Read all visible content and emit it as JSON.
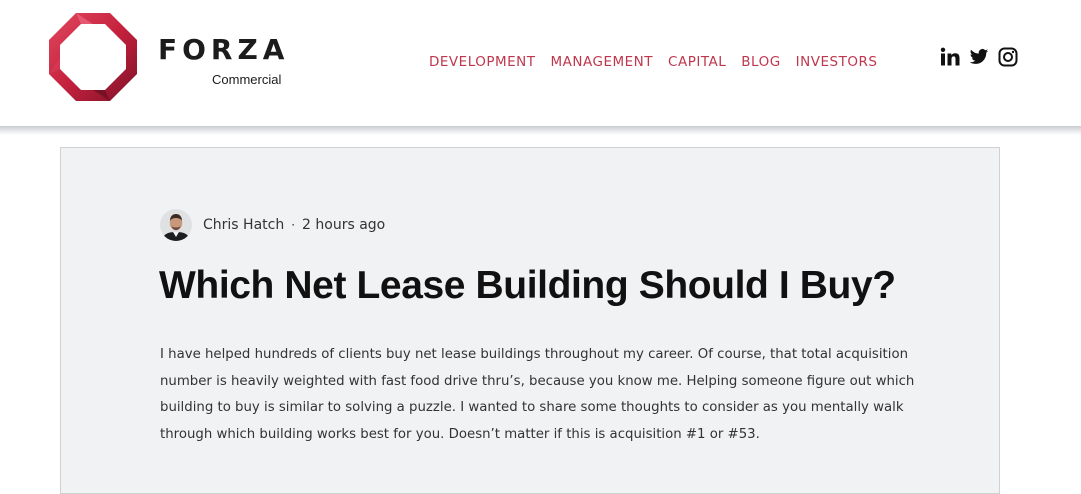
{
  "brand": {
    "name": "FORZA",
    "subtitle": "Commercial",
    "logo_icon": "red-octagon-ring-logo",
    "colors": {
      "logo_dark": "#8e1630",
      "logo_light": "#e04158"
    }
  },
  "nav": {
    "items": [
      {
        "label": "DEVELOPMENT"
      },
      {
        "label": "MANAGEMENT"
      },
      {
        "label": "CAPITAL"
      },
      {
        "label": "BLOG"
      },
      {
        "label": "INVESTORS"
      }
    ],
    "color": "#c0374d"
  },
  "social": [
    {
      "icon": "linkedin-icon"
    },
    {
      "icon": "twitter-icon"
    },
    {
      "icon": "instagram-icon"
    }
  ],
  "post": {
    "author": "Chris Hatch",
    "separator": "·",
    "time": "2 hours ago",
    "title": "Which Net Lease Building Should I Buy?",
    "body": "I have helped hundreds of clients buy net lease buildings throughout my career. Of course, that total acquisition number is heavily weighted with fast food drive thru’s, because you know me. Helping someone figure out which building to buy is similar to solving a puzzle. I wanted to share some thoughts to consider as you mentally walk through which building works best for you. Doesn’t matter if this is acquisition #1 or #53."
  }
}
